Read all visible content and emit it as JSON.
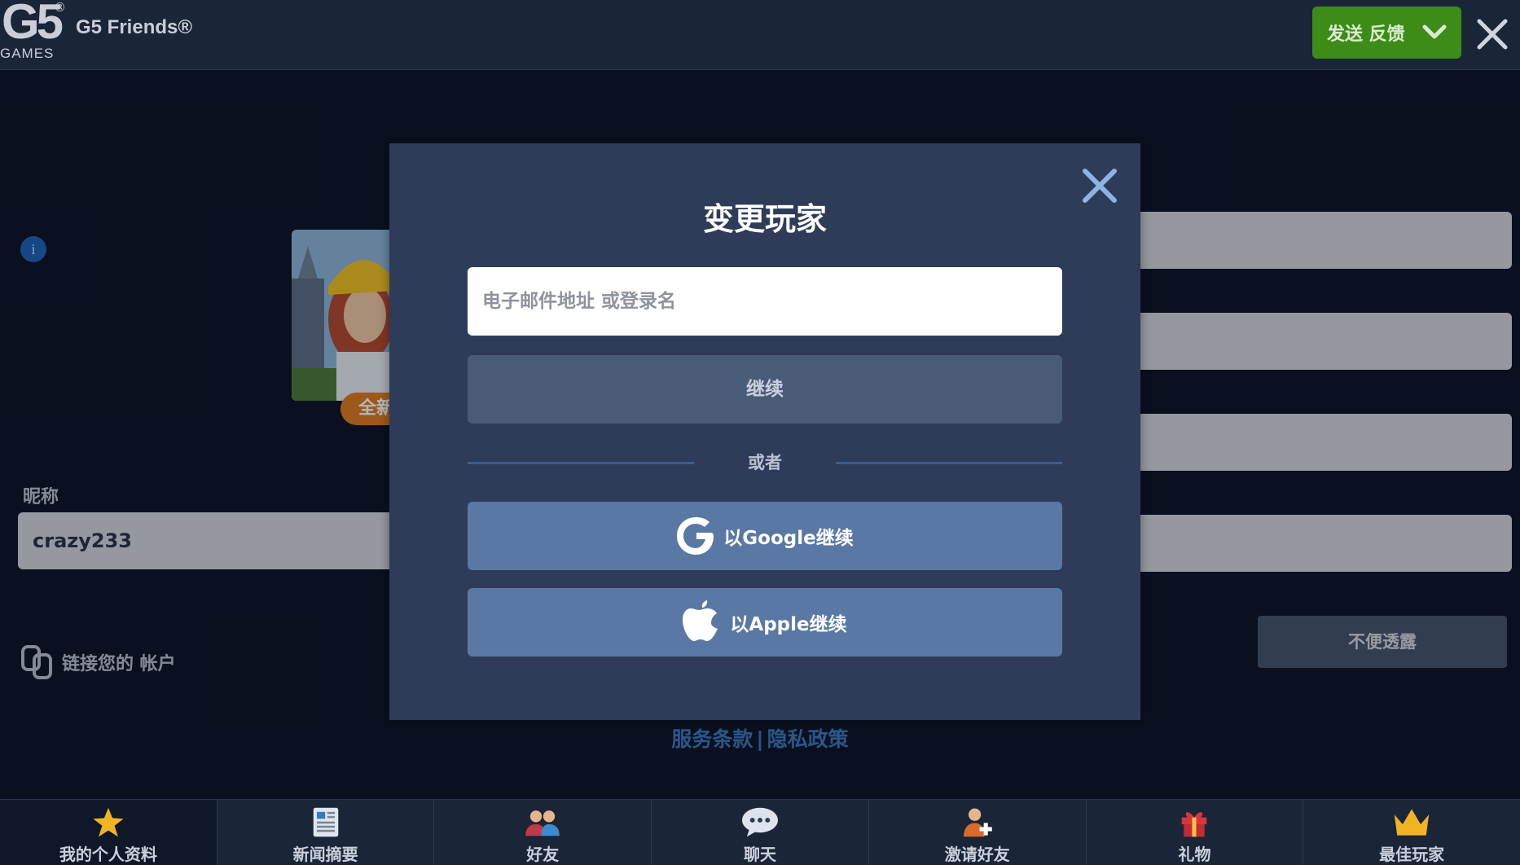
{
  "header": {
    "logo_text": "G5",
    "logo_sub": "GAMES",
    "logo_registered": "®",
    "brand": "G5 Friends®",
    "feedback_label": "发送 反馈"
  },
  "profile": {
    "new_badge": "全新",
    "nickname_label": "昵称",
    "nickname_value": "crazy233",
    "link_account_label": "链接您的 帐户",
    "gender_option": "不便透露"
  },
  "legal": {
    "terms": "服务条款",
    "separator": "|",
    "privacy": "隐私政策"
  },
  "modal": {
    "title": "变更玩家",
    "email_placeholder": "电子邮件地址 或登录名",
    "continue_label": "继续",
    "or_label": "或者",
    "google_label": "以Google继续",
    "apple_label": "以Apple继续"
  },
  "nav": {
    "items": [
      {
        "label": "我的个人资料",
        "icon": "star-icon"
      },
      {
        "label": "新闻摘要",
        "icon": "newspaper-icon"
      },
      {
        "label": "好友",
        "icon": "friends-icon"
      },
      {
        "label": "聊天",
        "icon": "chat-bubble-icon"
      },
      {
        "label": "激请好友",
        "icon": "invite-friend-icon"
      },
      {
        "label": "礼物",
        "icon": "gift-icon"
      },
      {
        "label": "最佳玩家",
        "icon": "crown-icon"
      }
    ]
  },
  "colors": {
    "background": "#0c1424",
    "topbar": "#1a2538",
    "feedback_green": "#3c8c17",
    "modal": "#2e3c59",
    "social_button": "#5a78a4",
    "link_blue": "#3b77bd"
  }
}
